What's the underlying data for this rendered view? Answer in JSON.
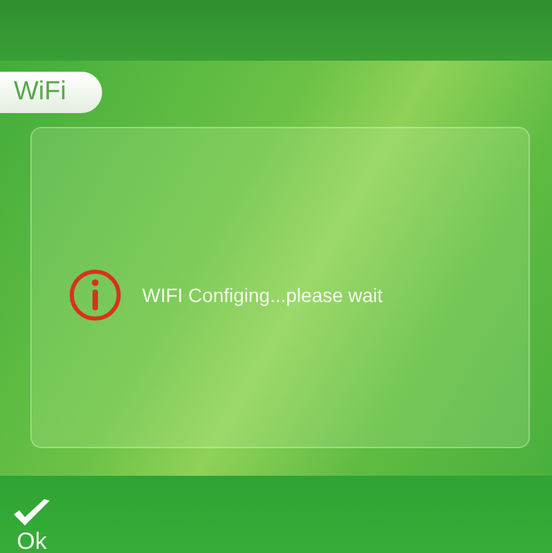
{
  "tab": {
    "label": "WiFi"
  },
  "message": {
    "text": "WIFI Configing...please wait"
  },
  "softkey": {
    "label": "Ok"
  }
}
